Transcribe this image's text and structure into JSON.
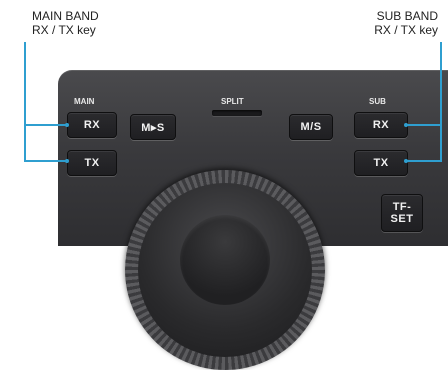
{
  "callouts": {
    "main": {
      "line1": "MAIN BAND",
      "line2": "RX / TX key"
    },
    "sub": {
      "line1": "SUB BAND",
      "line2": "RX / TX key"
    }
  },
  "panel": {
    "main_label": "MAIN",
    "sub_label": "SUB",
    "split_label": "SPLIT",
    "keys": {
      "main_rx": "RX",
      "main_tx": "TX",
      "m_to_s": "M▸S",
      "m_slash_s": "M/S",
      "sub_rx": "RX",
      "sub_tx": "TX",
      "tf_set_line1": "TF-",
      "tf_set_line2": "SET"
    }
  },
  "colors": {
    "callout_line": "#2f9fd0",
    "panel": "#3a3a3d",
    "key": "#222225"
  },
  "icons": {
    "dial": "main-tuning-dial"
  }
}
